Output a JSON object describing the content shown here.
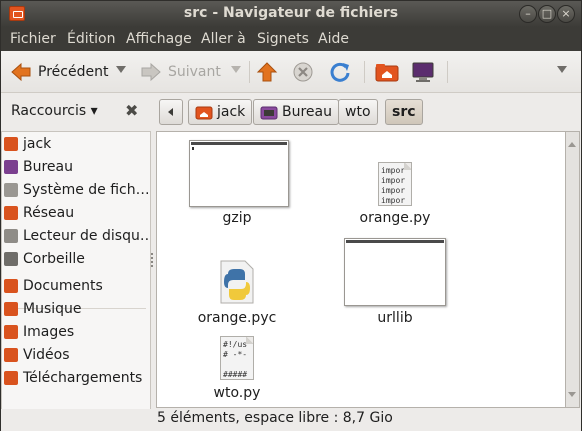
{
  "window": {
    "title": "src - Navigateur de fichiers"
  },
  "menubar": [
    "Fichier",
    "Édition",
    "Affichage",
    "Aller à",
    "Signets",
    "Aide"
  ],
  "toolbar": {
    "back_label": "Précédent",
    "forward_label": "Suivant"
  },
  "sidebar": {
    "header_label": "Raccourcis",
    "items": [
      {
        "label": "jack",
        "icon": "home-folder-icon",
        "color": "#d9531e"
      },
      {
        "label": "Bureau",
        "icon": "desktop-folder-icon",
        "color": "#7b3f8f"
      },
      {
        "label": "Système de fich…",
        "icon": "drive-icon",
        "color": "#9a9792"
      },
      {
        "label": "Réseau",
        "icon": "network-folder-icon",
        "color": "#d9531e"
      },
      {
        "label": "Lecteur de disqu…",
        "icon": "drive-icon",
        "color": "#8f8c87"
      },
      {
        "label": "Corbeille",
        "icon": "trash-icon",
        "color": "#6f6d69"
      },
      {
        "label": "Documents",
        "icon": "documents-folder-icon",
        "color": "#d9531e"
      },
      {
        "label": "Musique",
        "icon": "music-folder-icon",
        "color": "#d9531e"
      },
      {
        "label": "Images",
        "icon": "pictures-folder-icon",
        "color": "#d9531e"
      },
      {
        "label": "Vidéos",
        "icon": "videos-folder-icon",
        "color": "#d9531e"
      },
      {
        "label": "Téléchargements",
        "icon": "downloads-folder-icon",
        "color": "#d9531e"
      }
    ]
  },
  "pathbar": [
    "jack",
    "Bureau",
    "wto",
    "src"
  ],
  "files": [
    {
      "name": "gzip",
      "type": "terminal-thumbnail"
    },
    {
      "name": "orange.py",
      "type": "text",
      "preview": "impor\nimpor\nimpor\nimpor"
    },
    {
      "name": "orange.pyc",
      "type": "python-icon"
    },
    {
      "name": "urllib",
      "type": "terminal-thumbnail"
    },
    {
      "name": "wto.py",
      "type": "text",
      "preview": "#!/us\n# -*-\n\n#####"
    }
  ],
  "status": "5 éléments, espace libre : 8,7 Gio"
}
